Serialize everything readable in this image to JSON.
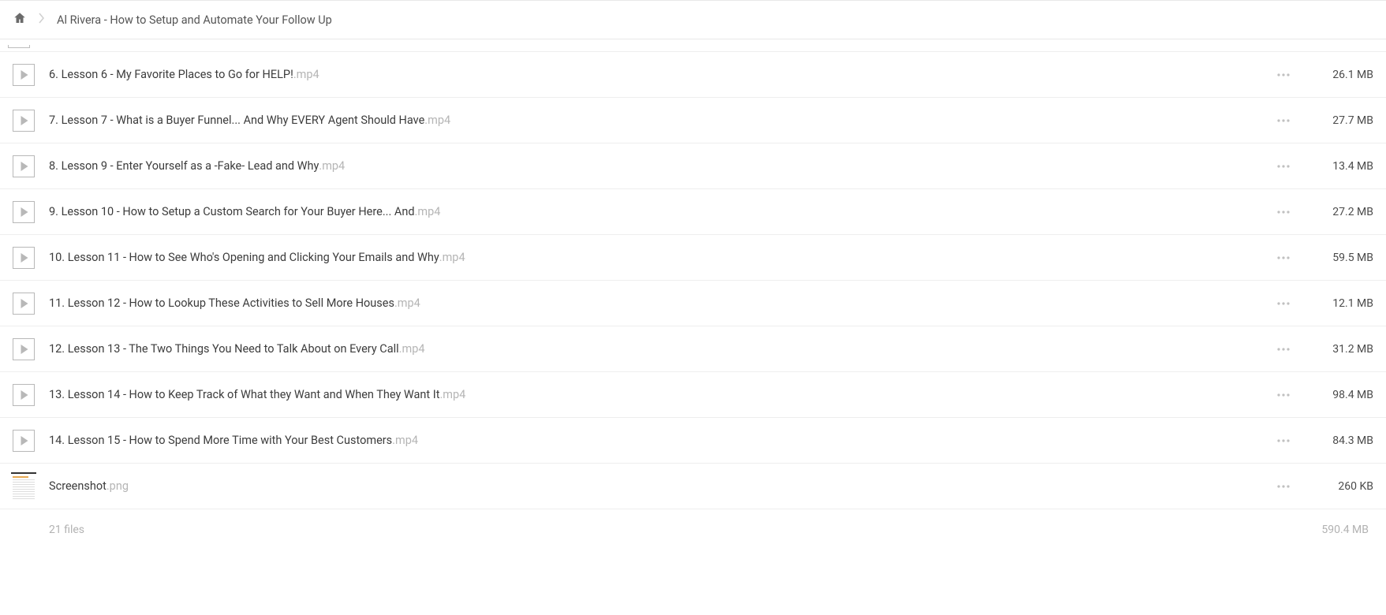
{
  "breadcrumb": {
    "title": "Al Rivera - How to Setup and Automate Your Follow Up"
  },
  "files": [
    {
      "name": "6. Lesson 6 - My Favorite Places to Go for HELP!",
      "ext": ".mp4",
      "size": "26.1 MB",
      "type": "video"
    },
    {
      "name": "7. Lesson 7 - What is a Buyer Funnel... And Why EVERY Agent Should Have",
      "ext": ".mp4",
      "size": "27.7 MB",
      "type": "video"
    },
    {
      "name": "8. Lesson 9 - Enter Yourself as a -Fake- Lead and Why",
      "ext": ".mp4",
      "size": "13.4 MB",
      "type": "video"
    },
    {
      "name": "9. Lesson 10 - How to Setup a Custom Search for Your Buyer Here... And",
      "ext": ".mp4",
      "size": "27.2 MB",
      "type": "video"
    },
    {
      "name": "10. Lesson 11 - How to See Who's Opening and Clicking Your Emails and Why",
      "ext": ".mp4",
      "size": "59.5 MB",
      "type": "video"
    },
    {
      "name": "11. Lesson 12 - How to Lookup These Activities to Sell More Houses",
      "ext": ".mp4",
      "size": "12.1 MB",
      "type": "video"
    },
    {
      "name": "12. Lesson 13 - The Two Things You Need to Talk About on Every Call",
      "ext": ".mp4",
      "size": "31.2 MB",
      "type": "video"
    },
    {
      "name": "13. Lesson 14 - How to Keep Track of What they Want and When They Want It",
      "ext": ".mp4",
      "size": "98.4 MB",
      "type": "video"
    },
    {
      "name": "14. Lesson 15 - How to Spend More Time with Your Best Customers",
      "ext": ".mp4",
      "size": "84.3 MB",
      "type": "video"
    },
    {
      "name": "Screenshot",
      "ext": ".png",
      "size": "260 KB",
      "type": "image"
    }
  ],
  "footer": {
    "count_label": "21 files",
    "total_size": "590.4 MB"
  }
}
